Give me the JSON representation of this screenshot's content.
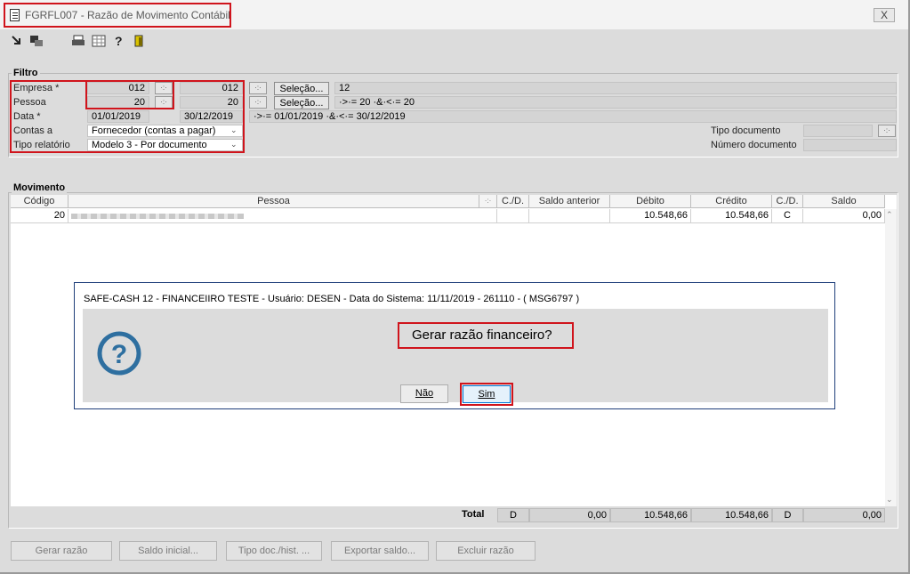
{
  "window": {
    "title": "FGRFL007 - Razão de Movimento Contábil",
    "close_label": "X"
  },
  "toolbar": {
    "icons": [
      "export-icon",
      "grid-icon",
      "print-icon",
      "table-icon",
      "help-icon",
      "exit-icon"
    ]
  },
  "filtro": {
    "title": "Filtro",
    "empresa": {
      "label": "Empresa *",
      "from": "012",
      "to": "012",
      "selecao_label": "Seleção...",
      "selecao_value": "12"
    },
    "pessoa": {
      "label": "Pessoa",
      "from": "20",
      "to": "20",
      "selecao_label": "Seleção...",
      "selecao_value": "·>·= 20 ·&·<·= 20"
    },
    "data": {
      "label": "Data *",
      "from": "01/01/2019",
      "to": "30/12/2019",
      "expression": "·>·= 01/01/2019 ·&·<·= 30/12/2019"
    },
    "contas_a": {
      "label": "Contas a",
      "value": "Fornecedor (contas a pagar)"
    },
    "tipo_relatorio": {
      "label": "Tipo relatório",
      "value": "Modelo 3 - Por documento"
    },
    "tipo_documento": {
      "label": "Tipo documento",
      "value": ""
    },
    "numero_documento": {
      "label": "Número documento",
      "value": ""
    }
  },
  "movimento": {
    "title": "Movimento",
    "columns": [
      "Código",
      "Pessoa",
      "C./D.",
      "Saldo anterior",
      "Débito",
      "Crédito",
      "C./D.",
      "Saldo"
    ],
    "rows": [
      {
        "codigo": "20",
        "pessoa": "",
        "cd1": "",
        "saldo_anterior": "",
        "debito": "10.548,66",
        "credito": "10.548,66",
        "cd2": "C",
        "saldo": "0,00"
      }
    ],
    "total": {
      "label": "Total",
      "cd1": "D",
      "saldo_anterior": "0,00",
      "debito": "10.548,66",
      "credito": "10.548,66",
      "cd2": "D",
      "saldo": "0,00"
    }
  },
  "buttons": {
    "gerar_razao": "Gerar razão",
    "saldo_inicial": "Saldo inicial...",
    "tipo_doc": "Tipo doc./hist. ...",
    "exportar_saldo": "Exportar saldo...",
    "excluir_razao": "Excluir razão"
  },
  "dialog": {
    "title": "SAFE-CASH 12 - FINANCEIIRO TESTE - Usuário: DESEN - Data do Sistema: 11/11/2019 - 261110 - ( MSG6797 )",
    "message": "Gerar razão financeiro?",
    "no_label": "Não",
    "yes_label": "Sim",
    "icon": "question-icon"
  },
  "colors": {
    "highlight": "#d0141c",
    "dialog_border": "#1f3f7a",
    "question_icon": "#2e6fa0"
  }
}
